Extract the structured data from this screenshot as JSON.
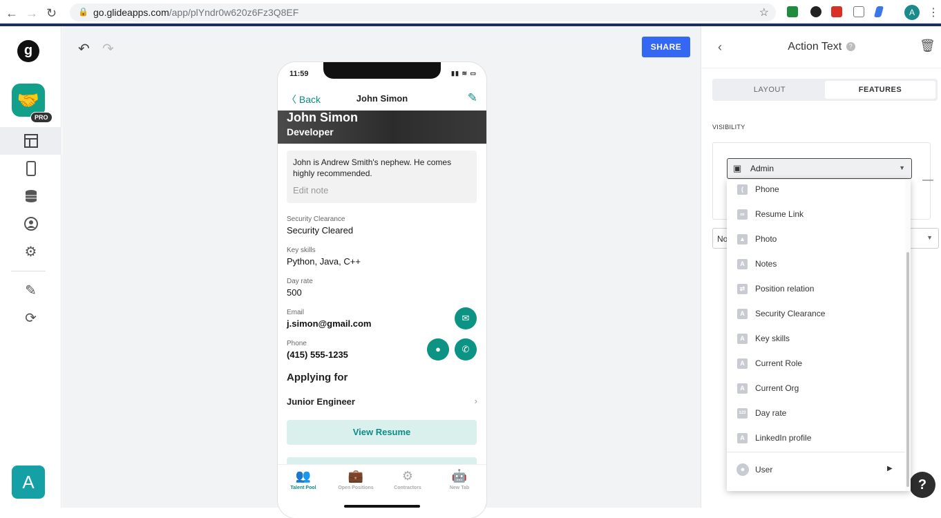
{
  "browser": {
    "url_domain": "go.glideapps.com",
    "url_path": "/app/plYndr0w620z6Fz3Q8EF",
    "profile_initial": "A"
  },
  "leftnav": {
    "logo_letter": "g",
    "pro_badge": "PRO",
    "user_initial": "A"
  },
  "toolbar": {
    "share_label": "SHARE"
  },
  "phone": {
    "time": "11:59",
    "back_label": "Back",
    "title": "John Simon",
    "hero_name": "John Simon",
    "hero_role": "Developer",
    "note_text": "John is Andrew Smith's nephew. He comes highly recommended.",
    "note_edit": "Edit note",
    "fields": [
      {
        "label": "Security Clearance",
        "value": "Security Cleared"
      },
      {
        "label": "Key skills",
        "value": "Python, Java, C++"
      },
      {
        "label": "Day rate",
        "value": "500"
      },
      {
        "label": "Email",
        "value": "j.simon@gmail.com"
      },
      {
        "label": "Phone",
        "value": "(415) 555-1235"
      }
    ],
    "section_title": "Applying for",
    "list_item": "Junior Engineer",
    "resume_button": "View Resume",
    "tabs": [
      {
        "label": "Talent Pool",
        "icon": "people-icon"
      },
      {
        "label": "Open Positions",
        "icon": "briefcase-icon"
      },
      {
        "label": "Contractors",
        "icon": "head-gear-icon"
      },
      {
        "label": "New Tab",
        "icon": "robot-icon"
      }
    ]
  },
  "rpanel": {
    "title": "Action Text",
    "seg_layout": "LAYOUT",
    "seg_features": "FEATURES",
    "visibility_label": "VISIBILITY",
    "partial_select": "No",
    "help": "?"
  },
  "visibility_select": {
    "selected": "Admin",
    "options": [
      {
        "label": "Phone",
        "icon": "phone-column-icon",
        "glyph": "("
      },
      {
        "label": "Resume Link",
        "icon": "link-icon",
        "glyph": "∞"
      },
      {
        "label": "Photo",
        "icon": "image-icon",
        "glyph": "▲"
      },
      {
        "label": "Notes",
        "icon": "text-column-icon",
        "glyph": "A"
      },
      {
        "label": "Position relation",
        "icon": "relation-icon",
        "glyph": "⇄"
      },
      {
        "label": "Security Clearance",
        "icon": "text-column-icon",
        "glyph": "A"
      },
      {
        "label": "Key skills",
        "icon": "text-column-icon",
        "glyph": "A"
      },
      {
        "label": "Current Role",
        "icon": "text-column-icon",
        "glyph": "A"
      },
      {
        "label": "Current Org",
        "icon": "text-column-icon",
        "glyph": "A"
      },
      {
        "label": "Day rate",
        "icon": "number-column-icon",
        "glyph": "123"
      },
      {
        "label": "LinkedIn profile",
        "icon": "text-column-icon",
        "glyph": "A"
      }
    ],
    "user_label": "User"
  },
  "colors": {
    "accent": "#0c8c84",
    "share_blue": "#3568f2"
  }
}
